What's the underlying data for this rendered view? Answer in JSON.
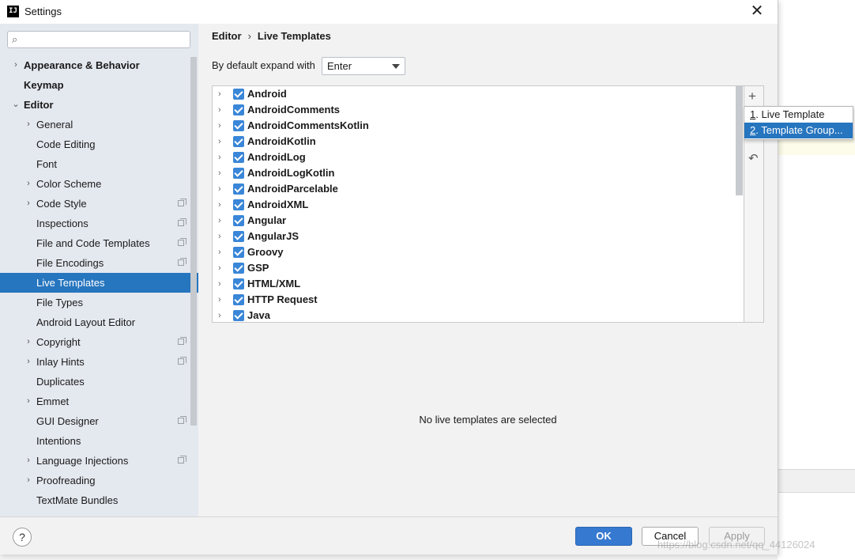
{
  "window": {
    "title": "Settings",
    "app_icon": "IJ"
  },
  "search": {
    "placeholder": ""
  },
  "sidebar": {
    "items": [
      {
        "label": "Appearance & Behavior",
        "arrow": "›",
        "bold": true
      },
      {
        "label": "Keymap",
        "bold": true
      },
      {
        "label": "Editor",
        "arrow": "⌄",
        "bold": true
      },
      {
        "label": "General",
        "arrow": "›"
      },
      {
        "label": "Code Editing"
      },
      {
        "label": "Font"
      },
      {
        "label": "Color Scheme",
        "arrow": "›"
      },
      {
        "label": "Code Style",
        "arrow": "›",
        "project": true
      },
      {
        "label": "Inspections",
        "project": true
      },
      {
        "label": "File and Code Templates",
        "project": true
      },
      {
        "label": "File Encodings",
        "project": true
      },
      {
        "label": "Live Templates",
        "selected": true
      },
      {
        "label": "File Types"
      },
      {
        "label": "Android Layout Editor"
      },
      {
        "label": "Copyright",
        "arrow": "›",
        "project": true
      },
      {
        "label": "Inlay Hints",
        "arrow": "›",
        "project": true
      },
      {
        "label": "Duplicates"
      },
      {
        "label": "Emmet",
        "arrow": "›"
      },
      {
        "label": "GUI Designer",
        "project": true
      },
      {
        "label": "Intentions"
      },
      {
        "label": "Language Injections",
        "arrow": "›",
        "project": true
      },
      {
        "label": "Proofreading",
        "arrow": "›"
      },
      {
        "label": "TextMate Bundles"
      }
    ]
  },
  "breadcrumb": {
    "parent": "Editor",
    "separator": "›",
    "current": "Live Templates"
  },
  "expand": {
    "label": "By default expand with",
    "value": "Enter"
  },
  "template_groups": [
    "Android",
    "AndroidComments",
    "AndroidCommentsKotlin",
    "AndroidKotlin",
    "AndroidLog",
    "AndroidLogKotlin",
    "AndroidParcelable",
    "AndroidXML",
    "Angular",
    "AngularJS",
    "Groovy",
    "GSP",
    "HTML/XML",
    "HTTP Request",
    "Java"
  ],
  "toolbar": {
    "add_icon": "+",
    "undo_icon": "↶"
  },
  "popup_menu": {
    "items": [
      {
        "mnemonic": "1",
        "label": ". Live Template"
      },
      {
        "mnemonic": "2",
        "label": ". Template Group...",
        "active": true
      }
    ]
  },
  "details": {
    "empty_text": "No live templates are selected"
  },
  "buttons": {
    "help": "?",
    "ok": "OK",
    "cancel": "Cancel",
    "apply": "Apply"
  },
  "watermark": "https://blog.csdn.net/qq_44126024",
  "colors": {
    "accent": "#2675bf",
    "ok_button": "#3679d0",
    "sidebar_bg": "#e4e8ef"
  }
}
